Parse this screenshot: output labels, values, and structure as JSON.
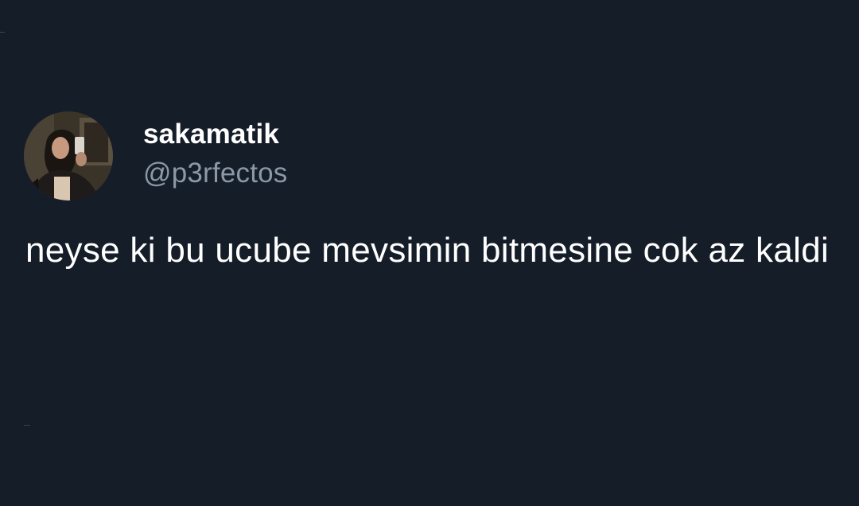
{
  "tweet": {
    "author": {
      "display_name": "sakamatik",
      "handle": "@p3rfectos",
      "avatar_icon": "profile-photo"
    },
    "text": "neyse ki bu ucube mevsimin bitmesine cok az kaldi"
  },
  "theme": {
    "background": "#151d28",
    "text": "#ffffff",
    "secondary_text": "#8b98a5"
  }
}
